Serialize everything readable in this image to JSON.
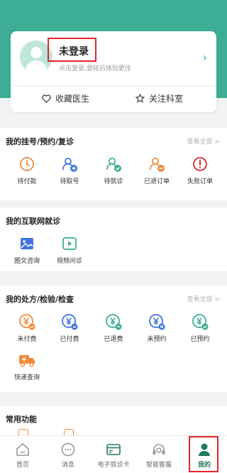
{
  "user": {
    "name": "未登录",
    "subtitle": "点击登录,登陆后体验更佳",
    "links": [
      {
        "label": "收藏医生",
        "icon": "heart-icon"
      },
      {
        "label": "关注科室",
        "icon": "star-icon"
      }
    ]
  },
  "registration": {
    "title": "我的挂号/预约/复诊",
    "more": "查看全部 >",
    "items": [
      {
        "label": "待付款",
        "icon": "clock-icon"
      },
      {
        "label": "待取号",
        "icon": "user-add-icon"
      },
      {
        "label": "待就诊",
        "icon": "user-check-icon"
      },
      {
        "label": "已退订单",
        "icon": "user-return-icon"
      },
      {
        "label": "失败订单",
        "icon": "alert-icon"
      }
    ]
  },
  "internet": {
    "title": "我的互联网就诊",
    "items": [
      {
        "label": "图文咨询",
        "icon": "image-icon"
      },
      {
        "label": "视频问诊",
        "icon": "video-icon"
      }
    ]
  },
  "prescription": {
    "title": "我的处方/检验/检查",
    "more": "查看全部 >",
    "items": [
      {
        "label": "未付费",
        "icon": "yen-icon"
      },
      {
        "label": "已付费",
        "icon": "yen-icon"
      },
      {
        "label": "已退费",
        "icon": "yen-icon"
      },
      {
        "label": "未预约",
        "icon": "yen-icon"
      },
      {
        "label": "已预约",
        "icon": "yen-icon"
      },
      {
        "label": "快递查询",
        "icon": "truck-icon"
      }
    ]
  },
  "common": {
    "title": "常用功能"
  },
  "tabbar": {
    "items": [
      {
        "label": "首页",
        "icon": "home-icon"
      },
      {
        "label": "消息",
        "icon": "message-icon"
      },
      {
        "label": "电子就诊卡",
        "icon": "card-icon"
      },
      {
        "label": "智能客服",
        "icon": "headset-icon"
      },
      {
        "label": "我的",
        "icon": "person-icon"
      }
    ],
    "active": "我的"
  },
  "colors": {
    "primary": "#3dae95",
    "orange": "#f08a3a",
    "blue": "#3f74e0",
    "red": "#e0262d"
  }
}
